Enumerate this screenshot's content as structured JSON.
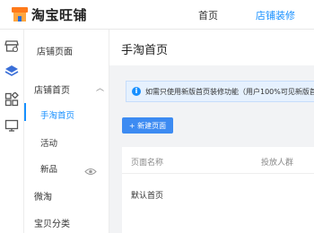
{
  "header": {
    "logo_text": "淘宝旺铺",
    "nav": [
      {
        "label": "首页"
      },
      {
        "label": "店铺装修"
      }
    ]
  },
  "rail": {
    "icons": [
      "store-icon",
      "layers-icon",
      "widgets-icon",
      "monitor-icon"
    ]
  },
  "sidebar": {
    "title": "店铺页面",
    "group_label": "店铺首页",
    "sub_items": [
      {
        "label": "手淘首页"
      },
      {
        "label": "活动"
      },
      {
        "label": "新品"
      }
    ],
    "top_items": [
      {
        "label": "微淘"
      },
      {
        "label": "宝贝分类"
      }
    ]
  },
  "main": {
    "title": "手淘首页",
    "notice": "i",
    "notice_text": "如需只使用新版首页装修功能（用户100%可见新版首页）",
    "new_button": "+ 新建页面",
    "table": {
      "columns": [
        "页面名称",
        "投放人群"
      ],
      "rows": [
        [
          "默认首页",
          ""
        ]
      ]
    }
  },
  "colors": {
    "accent": "#1890ff",
    "button": "#3d8bf2",
    "notice_bg": "#e6f1fe",
    "logo_orange": "#ff7a1a"
  }
}
